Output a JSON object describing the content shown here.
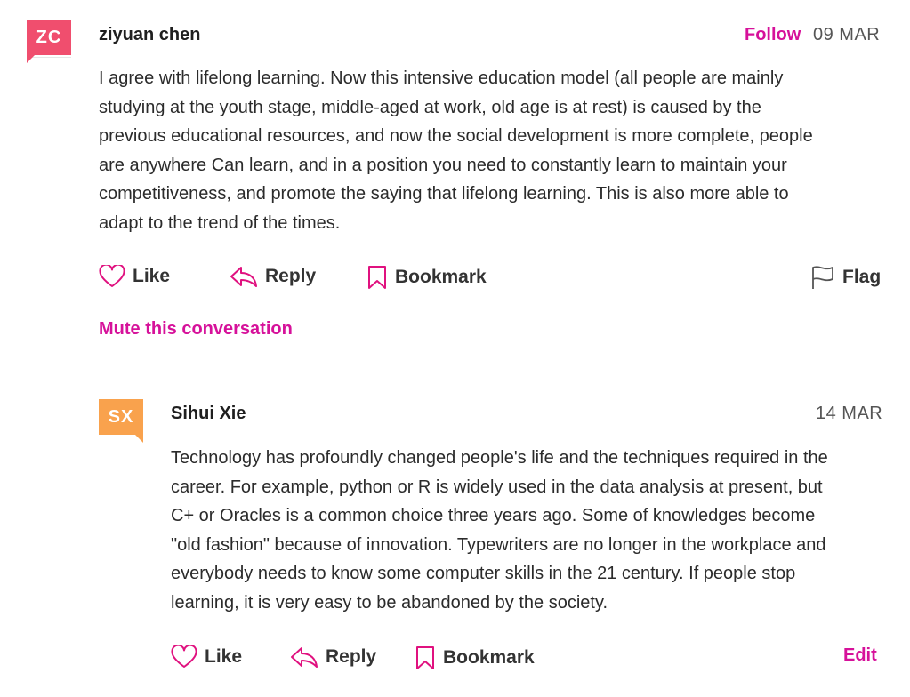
{
  "comments": [
    {
      "initials": "ZC",
      "author": "ziyuan chen",
      "follow_label": "Follow",
      "date": "09 MAR",
      "body_lines": [
        "I agree with lifelong learning. Now this intensive education model (all people are mainly",
        "studying at the youth stage, middle-aged at work, old age is at rest) is caused by the",
        "previous educational resources, and now the social development is more complete, people",
        "are anywhere Can learn, and in a position you need to constantly learn to maintain your",
        "competitiveness, and promote the saying that lifelong learning. This is also more able to",
        "adapt to the trend of the times."
      ],
      "actions": {
        "like": "Like",
        "reply": "Reply",
        "bookmark": "Bookmark",
        "flag": "Flag"
      },
      "mute_label": "Mute this conversation",
      "avatar_color": "#f04e6e"
    },
    {
      "initials": "SX",
      "author": "Sihui Xie",
      "date": "14 MAR",
      "body_lines": [
        "Technology has profoundly changed people's life and the techniques required in the",
        "career. For example, python or R is widely used in the data analysis at present, but",
        "C+ or Oracles is a common choice three years ago. Some of knowledges become",
        "\"old fashion\" because of innovation. Typewriters are no longer in the workplace and",
        "everybody needs to know some computer skills in the 21 century. If people stop",
        "learning, it is very easy to be abandoned by the society."
      ],
      "actions": {
        "like": "Like",
        "reply": "Reply",
        "bookmark": "Bookmark",
        "edit": "Edit"
      },
      "avatar_color": "#f9a24d"
    }
  ],
  "colors": {
    "accent": "#d6119a",
    "heart": "#e0117f",
    "text": "#2b2b2b"
  },
  "icons": [
    "heart-icon",
    "reply-icon",
    "bookmark-icon",
    "flag-icon"
  ]
}
